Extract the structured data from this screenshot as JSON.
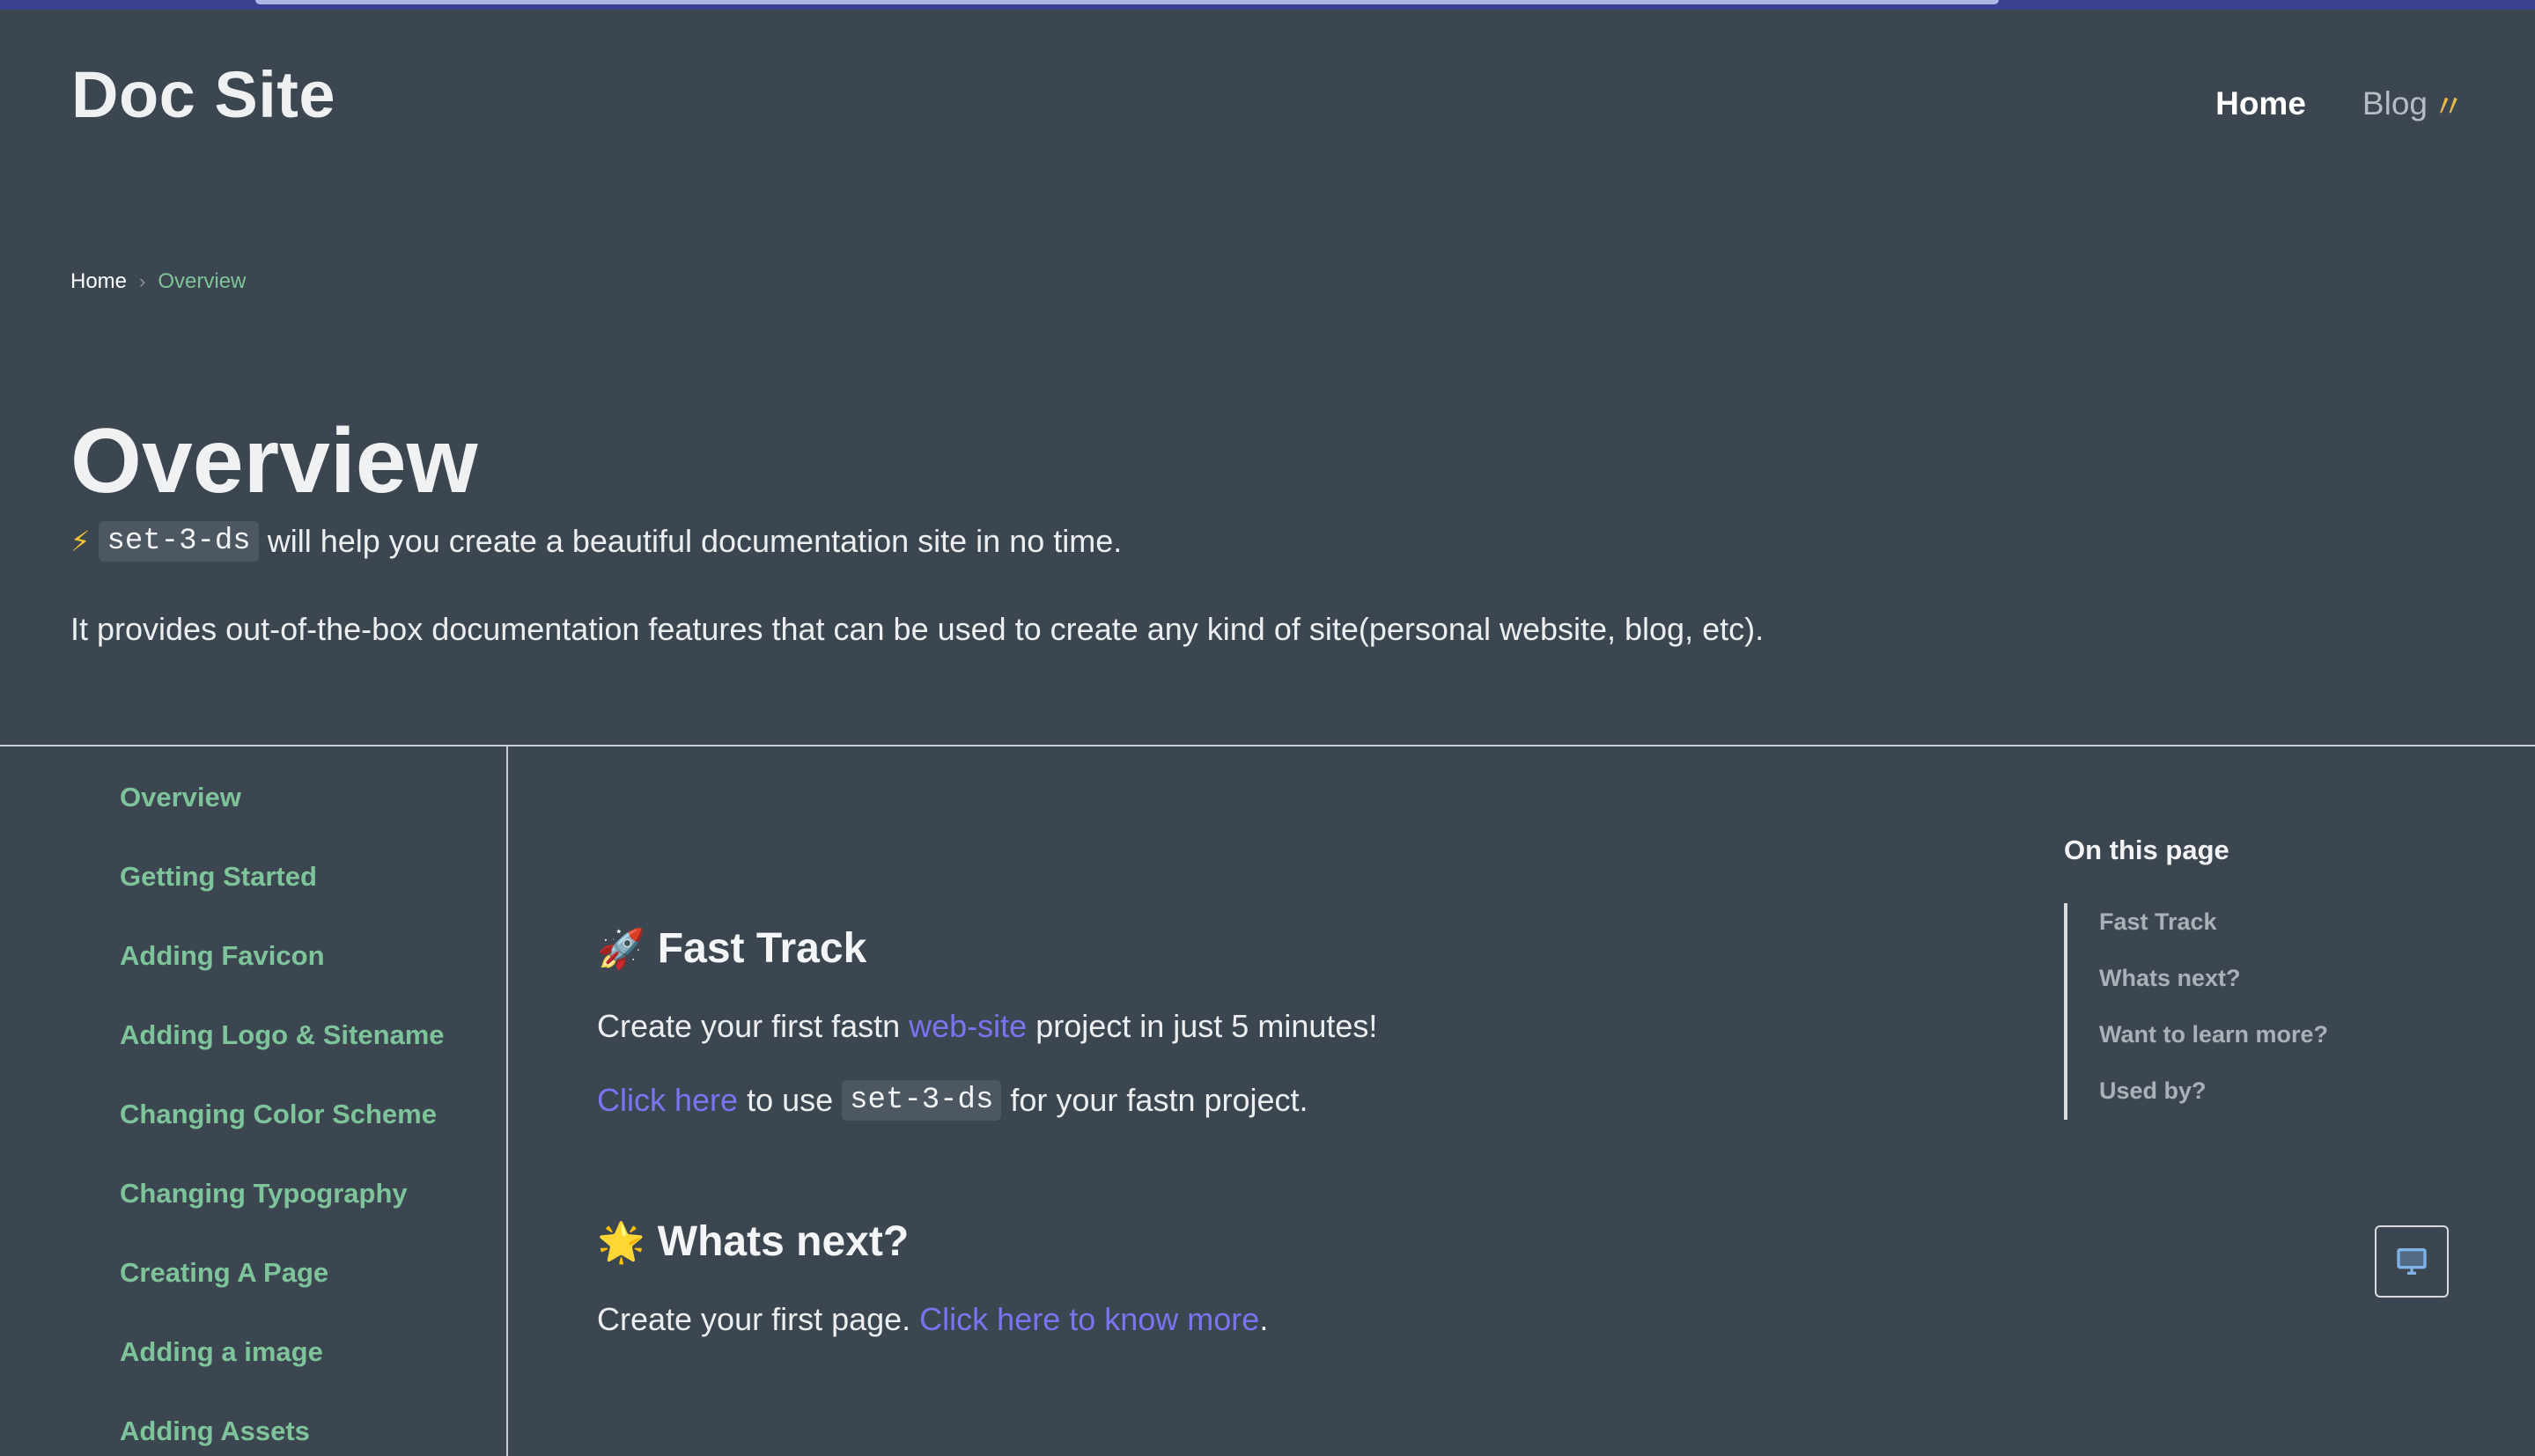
{
  "site": {
    "title": "Doc Site"
  },
  "nav": {
    "home": "Home",
    "blog": "Blog"
  },
  "breadcrumb": {
    "home": "Home",
    "current": "Overview"
  },
  "page": {
    "title": "Overview",
    "intro_code": "set-3-ds",
    "intro_text": "will help you create a beautiful documentation site in no time.",
    "intro2": "It provides out-of-the-box documentation features that can be used to create any kind of site(personal website, blog, etc)."
  },
  "sidebar": {
    "items": [
      "Overview",
      "Getting Started",
      "Adding Favicon",
      "Adding Logo & Sitename",
      "Changing Color Scheme",
      "Changing Typography",
      "Creating A Page",
      "Adding a image",
      "Adding Assets"
    ]
  },
  "content": {
    "fast_track": {
      "title": "Fast Track",
      "p1_pre": "Create your first fastn",
      "p1_link": "web-site",
      "p1_post": "project in just 5 minutes!",
      "p2_link": "Click here",
      "p2_mid": "to use",
      "p2_code": "set-3-ds",
      "p2_post": "for your fastn project."
    },
    "whats_next": {
      "title": "Whats next?",
      "p1_pre": "Create your first page.",
      "p1_link": "Click here to know more",
      "p1_post": "."
    }
  },
  "toc": {
    "title": "On this page",
    "items": [
      "Fast Track",
      "Whats next?",
      "Want to learn more?",
      "Used by?"
    ]
  },
  "icons": {
    "bolt": "lightning-icon",
    "rocket": "rocket-icon",
    "star": "star-icon",
    "construction": "construction-icon",
    "device": "desktop-icon"
  },
  "colors": {
    "background": "#3c4650",
    "accent_green": "#7ec49a",
    "link": "#7c73f0"
  }
}
